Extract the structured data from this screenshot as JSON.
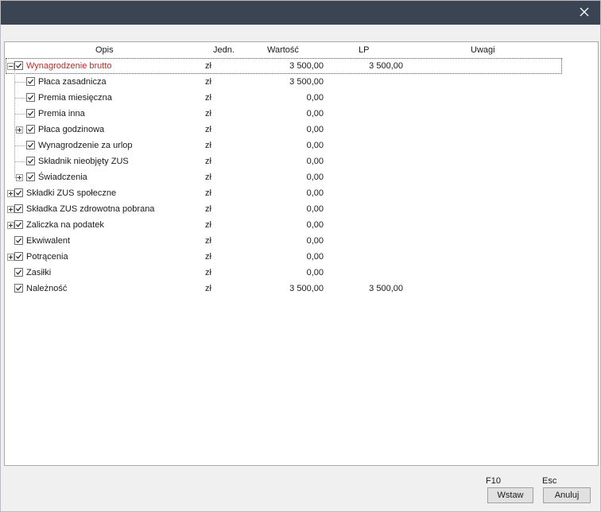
{
  "window": {
    "close_icon": "close-icon"
  },
  "columns": {
    "opis": "Opis",
    "jedn": "Jedn.",
    "wartosc": "Wartość",
    "lp": "LP",
    "uwagi": "Uwagi"
  },
  "rows": [
    {
      "label": "Wynagrodzenie brutto",
      "unit": "zł",
      "value": "3 500,00",
      "lp": "3 500,00",
      "level": 0,
      "expander": "minus",
      "checked": true,
      "selected": true,
      "color": "#d0261f"
    },
    {
      "label": "Płaca zasadnicza",
      "unit": "zł",
      "value": "3 500,00",
      "lp": "",
      "level": 1,
      "expander": "",
      "checked": true
    },
    {
      "label": "Premia miesięczna",
      "unit": "zł",
      "value": "0,00",
      "lp": "",
      "level": 1,
      "expander": "",
      "checked": true
    },
    {
      "label": "Premia inna",
      "unit": "zł",
      "value": "0,00",
      "lp": "",
      "level": 1,
      "expander": "",
      "checked": true
    },
    {
      "label": "Płaca godzinowa",
      "unit": "zł",
      "value": "0,00",
      "lp": "",
      "level": 1,
      "expander": "plus",
      "checked": true
    },
    {
      "label": "Wynagrodzenie za urlop",
      "unit": "zł",
      "value": "0,00",
      "lp": "",
      "level": 1,
      "expander": "",
      "checked": true
    },
    {
      "label": "Składnik nieobjęty ZUS",
      "unit": "zł",
      "value": "0,00",
      "lp": "",
      "level": 1,
      "expander": "",
      "checked": true
    },
    {
      "label": "Świadczenia",
      "unit": "zł",
      "value": "0,00",
      "lp": "",
      "level": 1,
      "expander": "plus",
      "checked": true
    },
    {
      "label": "Składki ZUS społeczne",
      "unit": "zł",
      "value": "0,00",
      "lp": "",
      "level": 0,
      "expander": "plus",
      "checked": true
    },
    {
      "label": "Składka ZUS zdrowotna pobrana",
      "unit": "zł",
      "value": "0,00",
      "lp": "",
      "level": 0,
      "expander": "plus",
      "checked": true
    },
    {
      "label": "Zaliczka na podatek",
      "unit": "zł",
      "value": "0,00",
      "lp": "",
      "level": 0,
      "expander": "plus",
      "checked": true
    },
    {
      "label": "Ekwiwalent",
      "unit": "zł",
      "value": "0,00",
      "lp": "",
      "level": 0,
      "expander": "",
      "checked": true
    },
    {
      "label": "Potrącenia",
      "unit": "zł",
      "value": "0,00",
      "lp": "",
      "level": 0,
      "expander": "plus",
      "checked": true
    },
    {
      "label": "Zasiłki",
      "unit": "zł",
      "value": "0,00",
      "lp": "",
      "level": 0,
      "expander": "",
      "checked": true
    },
    {
      "label": "Należność",
      "unit": "zł",
      "value": "3 500,00",
      "lp": "3 500,00",
      "level": 0,
      "expander": "",
      "checked": true
    }
  ],
  "footer": {
    "wstaw_key": "F10",
    "wstaw_label": "Wstaw",
    "anuluj_key": "Esc",
    "anuluj_label": "Anuluj"
  }
}
